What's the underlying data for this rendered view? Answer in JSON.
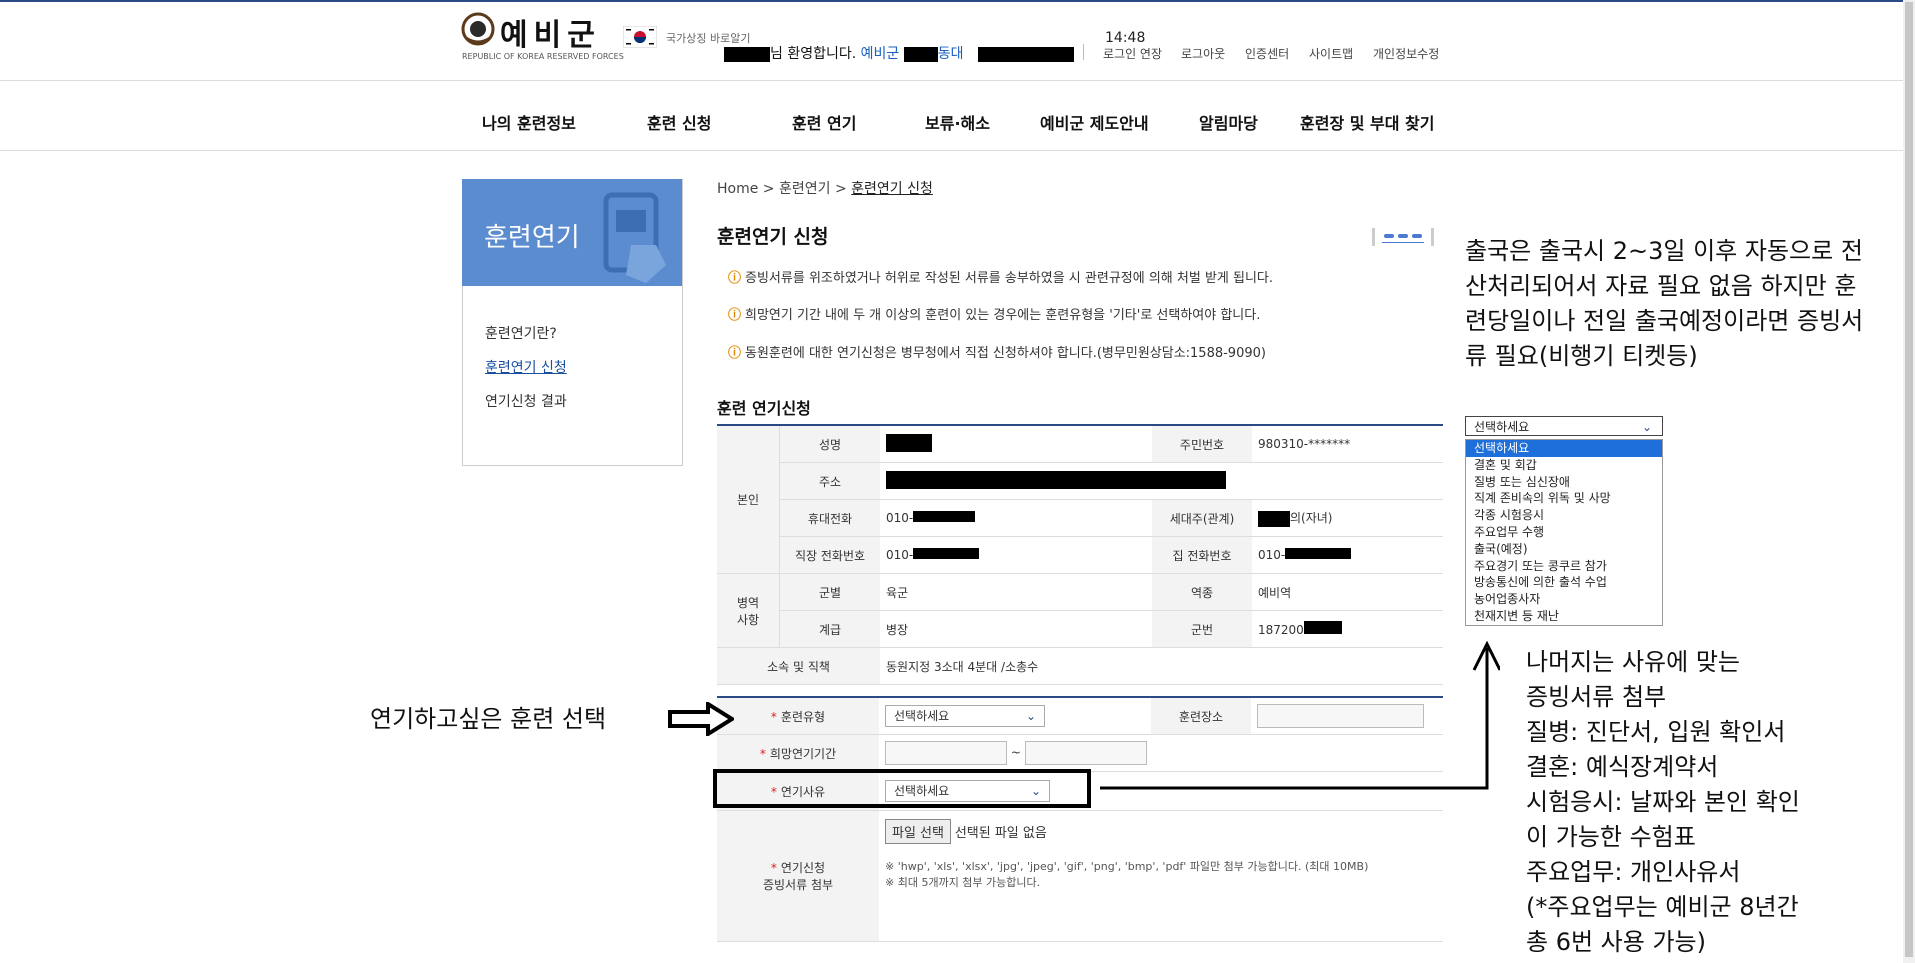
{
  "header": {
    "logo_text": "예비군",
    "logo_sub": "REPUBLIC OF KOREA RESERVED FORCES",
    "symbol_link": "국가상징 바로알기",
    "greeting_suffix": "님 환영합니다.",
    "unit_prefix": "예비군",
    "unit_suffix": "동대",
    "clock": "14:48",
    "utils": [
      "로그인 연장",
      "로그아웃",
      "인증센터",
      "사이트맵",
      "개인정보수정"
    ]
  },
  "nav": [
    "나의 훈련정보",
    "훈련 신청",
    "훈련 연기",
    "보류·해소",
    "예비군 제도안내",
    "알림마당",
    "훈련장 및 부대 찾기"
  ],
  "sidebar": {
    "title": "훈련연기",
    "items": [
      "훈련연기란?",
      "훈련연기 신청",
      "연기신청 결과"
    ]
  },
  "breadcrumb": {
    "home": "Home",
    "level1": "훈련연기",
    "current": "훈련연기 신청"
  },
  "page_title": "훈련연기 신청",
  "notices": [
    "증빙서류를 위조하였거나 허위로 작성된 서류를 송부하였을 시 관련규정에 의해 처벌 받게 됩니다.",
    "희망연기 기간 내에 두 개 이상의 훈련이 있는 경우에는 훈련유형을 '기타'로 선택하여야 합니다.",
    "동원훈련에 대한 연기신청은 병무청에서 직접 신청하셔야 합니다.(병무민원상담소:1588-9090)"
  ],
  "section_title": "훈련 연기신청",
  "personal": {
    "group_self": "본인",
    "group_military": "병역\n사항",
    "name_label": "성명",
    "rrn_label": "주민번호",
    "rrn_value": "980310-*******",
    "address_label": "주소",
    "mobile_label": "휴대전화",
    "mobile_prefix": "010-",
    "head_label": "세대주(관계)",
    "head_suffix": "의(자녀)",
    "work_phone_label": "직장 전화번호",
    "work_phone_prefix": "010-",
    "home_phone_label": "집 전화번호",
    "home_phone_prefix": "010-",
    "branch_label": "군별",
    "branch_value": "육군",
    "service_label": "역종",
    "service_value": "예비역",
    "rank_label": "계급",
    "rank_value": "병장",
    "serial_label": "군번",
    "serial_prefix": "187200",
    "unit_label": "소속 및 직책",
    "unit_value": "동원지정 3소대 4분대 /소총수"
  },
  "request": {
    "type_label": "훈련유형",
    "type_value": "선택하세요",
    "place_label": "훈련장소",
    "period_label": "희망연기기간",
    "period_sep": "~",
    "reason_label": "연기사유",
    "reason_value": "선택하세요",
    "attach_label": "연기신청\n증빙서류 첨부",
    "file_button": "파일 선택",
    "file_status": "선택된 파일 없음",
    "file_note1": "※ 'hwp', 'xls', 'xlsx', 'jpg', 'jpeg', 'gif', 'png', 'bmp', 'pdf' 파일만 첨부 가능합니다. (최대 10MB)",
    "file_note2": "※ 최대 5개까지 첨부 가능합니다."
  },
  "dropdown": {
    "selected": "선택하세요",
    "options": [
      "선택하세요",
      "결혼 및 회갑",
      "질병 또는 심신장애",
      "직계 존비속의 위독 및 사망",
      "각종 시험응시",
      "주요업무 수행",
      "출국(예정)",
      "주요경기 또는 콩쿠르 참가",
      "방송통신에 의한 출석 수업",
      "농어업종사자",
      "천재지변 등 재난"
    ]
  },
  "annotations": {
    "top": "출국은 출국시 2~3일 이후 자동으로 전산처리되어서 자료 필요 없음 하지만 훈련당일이나 전일 출국예정이라면 증빙서류 필요(비행기 티켓등)",
    "left": "연기하고싶은 훈련 선택",
    "bottom": [
      "나머지는 사유에 맞는",
      "증빙서류 첨부",
      "질병: 진단서, 입원 확인서",
      "결혼: 예식장계약서",
      "시험응시: 날짜와 본인 확인",
      "이 가능한 수험표",
      "주요업무: 개인사유서",
      "(*주요업무는 예비군 8년간",
      "총 6번 사용 가능)"
    ]
  }
}
